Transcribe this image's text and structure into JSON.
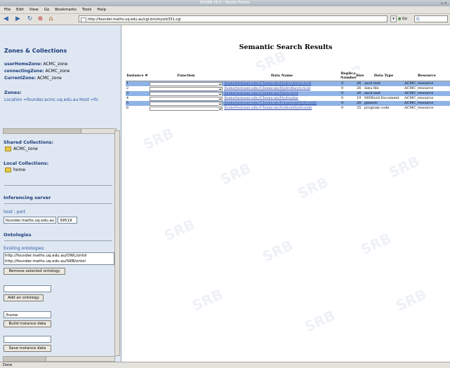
{
  "window": {
    "title": "MYSRB V8.5 - Mozilla Firefox"
  },
  "menu": [
    "File",
    "Edit",
    "View",
    "Go",
    "Bookmarks",
    "Tools",
    "Help"
  ],
  "nav": {
    "url": "http://founder.maths.uq.edu.au/cgi-bin/mysrb331.cgi",
    "go_label": "Go",
    "search_value": "G"
  },
  "left": {
    "heading": "Zones & Collections",
    "userHomeZone_label": "userHomeZone:",
    "userHomeZone_value": "ACMC_zone",
    "connectingZone_label": "connectingZone:",
    "connectingZone_value": "ACMC_zone",
    "currentZone_label": "CurrentZone:",
    "currentZone_value": "ACMC_zone",
    "zones_label": "Zones:",
    "zone_location": "Location =founder.acmc.uq.edu.au:Host =fo",
    "shared_label": "Shared Collections:",
    "shared_item": "ACMC_zone",
    "local_label": "Local Collections:",
    "local_item": "home",
    "inferencing_heading": "Inferencing server",
    "host_label": "host : port",
    "host_value": "founder.maths.uq.edu.au",
    "port_value": "39519",
    "ontologies_heading": "Ontologies",
    "existing_label": "Existing ontologies:",
    "ontology_items": [
      "http://founder.maths.uq.edu.au/OWL/ontol",
      "http://founder.maths.uq.edu.au/SRB/ontol"
    ],
    "remove_button": "Remove selected ontology",
    "add_input": "",
    "add_button": "Add an ontology",
    "instance_input": "/home",
    "build_button": "Build instance data",
    "save_input": "",
    "save_button": "Save instance data"
  },
  "main": {
    "title": "Semantic Search Results",
    "columns": [
      "Instance #",
      "Function",
      "Data Name",
      "Replica Number",
      "Size",
      "Data Type",
      "Resource"
    ],
    "rows": [
      {
        "instance": "1",
        "data_name": "/home/testuser.sdsc/Chemicals/HydrochloricAcid",
        "replica": "0",
        "size": "26",
        "type": "ascii text",
        "resource": "ACMC_resource"
      },
      {
        "instance": "2",
        "data_name": "/home/testuser.sdsc/Chemicals/HydrofluoricAcid",
        "replica": "0",
        "size": "26",
        "type": "data file",
        "resource": "ACMC_resource"
      },
      {
        "instance": "3",
        "data_name": "/home/testuser.sdsc/Chemicals/NitricAcid",
        "replica": "0",
        "size": "26",
        "type": "ascii text",
        "resource": "ACMC_resource"
      },
      {
        "instance": "4",
        "data_name": "/home/testuser.sdsc/Chemicals/Hydrazine",
        "replica": "0",
        "size": "19",
        "type": "MSWord Document",
        "resource": "ACMC_resource"
      },
      {
        "instance": "5",
        "data_name": "/home/testuser.sdsc/Chemicals/PotassiumHydroxide",
        "replica": "0",
        "size": "28",
        "type": "generic",
        "resource": "ACMC_resource"
      },
      {
        "instance": "6",
        "data_name": "/home/testuser.sdsc/Chemicals/SodiumHydroxide",
        "replica": "0",
        "size": "25",
        "type": "program code",
        "resource": "ACMC_resource"
      }
    ],
    "watermark": "SRB"
  },
  "status": {
    "text": "Done"
  }
}
